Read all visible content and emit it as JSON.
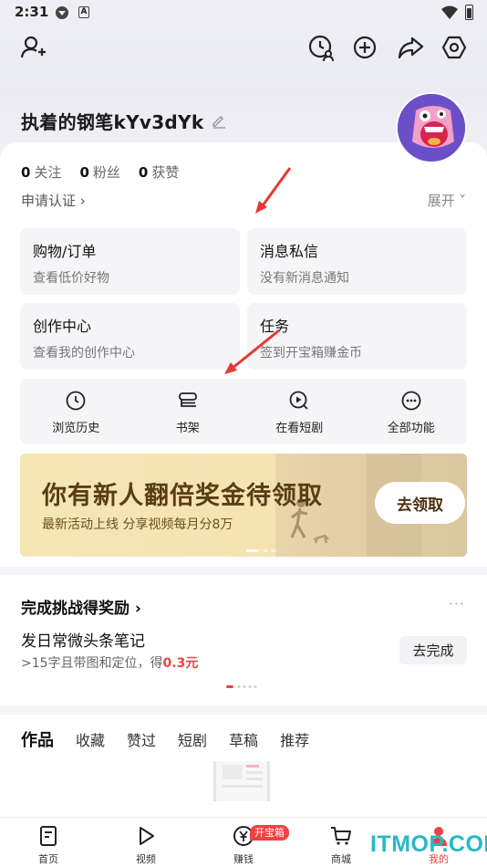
{
  "status_bar": {
    "time": "2:31",
    "icon_a": "A"
  },
  "header": {
    "icons": [
      "add-friend-icon",
      "history-user-icon",
      "plus-circle-icon",
      "share-icon",
      "settings-icon"
    ]
  },
  "profile": {
    "username": "执着的钢笔kYv3dYk",
    "stats": [
      {
        "num": "0",
        "label": "关注"
      },
      {
        "num": "0",
        "label": "粉丝"
      },
      {
        "num": "0",
        "label": "获赞"
      }
    ],
    "verify": "申请认证 ›",
    "expand": "展开 ˅"
  },
  "grid": [
    {
      "title": "购物/订单",
      "sub": "查看低价好物"
    },
    {
      "title": "消息私信",
      "sub": "没有新消息通知"
    },
    {
      "title": "创作中心",
      "sub": "查看我的创作中心"
    },
    {
      "title": "任务",
      "sub": "签到开宝箱赚金币"
    }
  ],
  "quick": [
    {
      "label": "浏览历史",
      "icon": "clock-icon"
    },
    {
      "label": "书架",
      "icon": "bookshelf-icon"
    },
    {
      "label": "在看短剧",
      "icon": "play-search-icon"
    },
    {
      "label": "全部功能",
      "icon": "more-circle-icon"
    }
  ],
  "banner": {
    "title": "你有新人翻倍奖金待领取",
    "sub": "最新活动上线 分享视频每月分8万",
    "button": "去领取"
  },
  "challenge": {
    "title": "完成挑战得奖励 ›",
    "more": "···",
    "task": "发日常微头条笔记",
    "desc_prefix": ">15字且带图和定位，得",
    "reward": "0.3元",
    "button": "去完成"
  },
  "works": {
    "tabs": [
      "作品",
      "收藏",
      "赞过",
      "短剧",
      "草稿",
      "推荐"
    ]
  },
  "bottom_nav": {
    "items": [
      {
        "label": "首页",
        "icon": "home-doc-icon"
      },
      {
        "label": "视频",
        "icon": "video-play-icon"
      },
      {
        "label": "赚钱",
        "icon": "yuan-icon"
      },
      {
        "label": "商城",
        "icon": "cart-icon"
      },
      {
        "label": "我的",
        "icon": "profile-icon"
      }
    ],
    "badge": "开宝箱"
  },
  "watermark": "ITMOP.COM",
  "colors": {
    "accent_red": "#f04142",
    "banner_text": "#5a3d13",
    "arrow_red": "#e53935"
  }
}
